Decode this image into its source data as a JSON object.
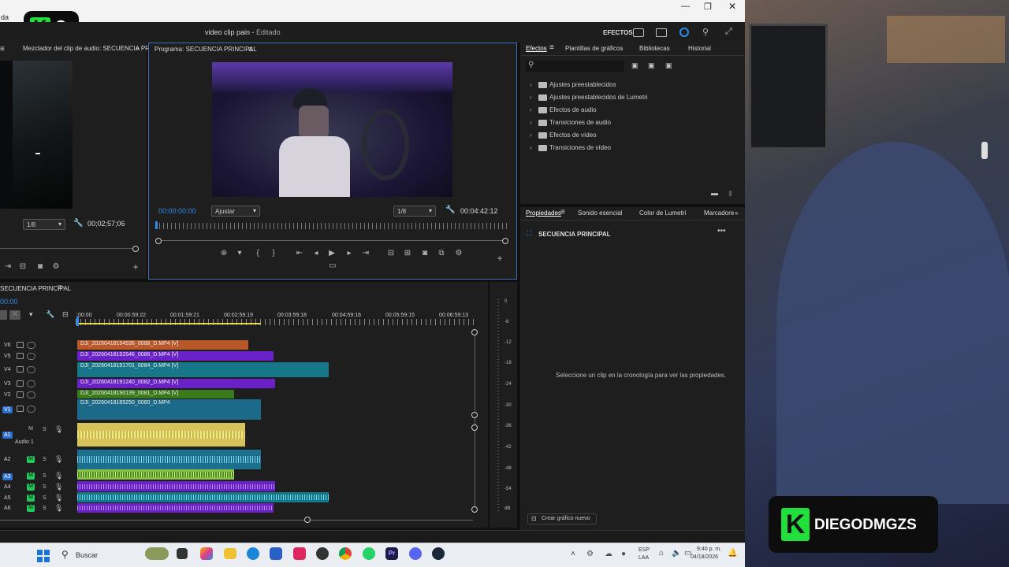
{
  "app": {
    "title": "video clip pain",
    "status": "Editado",
    "left_fragment": "da",
    "effects_label": "EFECTOS"
  },
  "logo": {
    "text": "K2"
  },
  "source_panel": {
    "title": "Mezclador del clip de audio: SECUENCIA PR",
    "zoom": "1/8",
    "timecode": "00;02;57;06"
  },
  "program_panel": {
    "title": "Programa: SECUENCIA PRINCIPAL",
    "current_tc": "00:00:00:00",
    "fit": "Ajustar",
    "res": "1/8",
    "duration": "00:04:42:12"
  },
  "effects_panel": {
    "tabs": [
      "Efectos",
      "Plantillas de gráficos",
      "Bibliotecas",
      "Historial"
    ],
    "search_placeholder": "",
    "items": [
      "Ajustes preestablecidos",
      "Ajustes preestablecidos de Lumetri",
      "Efectos de audio",
      "Transiciones de audio",
      "Efectos de vídeo",
      "Transiciones de vídeo"
    ]
  },
  "properties_panel": {
    "tabs": [
      "Propiedades",
      "Sonido esencial",
      "Color de Lumetri",
      "Marcadore"
    ],
    "sequence": "SECUENCIA PRINCIPAL",
    "empty_message": "Seleccione un clip en la cronología para ver las propiedades.",
    "create_button": "Crear gráfico nuevo"
  },
  "timeline": {
    "title": "SECUENCIA PRINCIPAL",
    "current_tc": "00:00",
    "ruler": [
      ":00:00",
      "00:00:59:22",
      "00:01:59:21",
      "00:02:59:19",
      "00:03:59:18",
      "00:04:59:16",
      "00:05:59:15",
      "00:06:59:13"
    ],
    "video_tracks": [
      {
        "name": "V6",
        "clip": "DJI_20260418194536_0088_D.MP4 [V]"
      },
      {
        "name": "V5",
        "clip": "DJI_20260418192546_0086_D.MP4 [V]"
      },
      {
        "name": "V4",
        "clip": "DJI_20260418191701_0084_D.MP4 [V]"
      },
      {
        "name": "V3",
        "clip": "DJI_20260418191240_0082_D.MP4 [V]"
      },
      {
        "name": "V2",
        "clip": "DJI_20260418190139_0081_D.MP4 [V]"
      },
      {
        "name": "V1",
        "clip": "DJI_20260418185250_0080_D.MP4"
      }
    ],
    "audio_tracks": [
      {
        "name": "A1",
        "label": "Audio 1"
      },
      {
        "name": "A2"
      },
      {
        "name": "A3"
      },
      {
        "name": "A4"
      },
      {
        "name": "A5"
      },
      {
        "name": "A6"
      }
    ],
    "mute": "M",
    "solo": "S"
  },
  "meter": {
    "ticks": [
      "0",
      "-6",
      "-12",
      "-18",
      "-24",
      "-30",
      "-36",
      "-42",
      "-48",
      "-54",
      "dB"
    ]
  },
  "taskbar": {
    "search": "Buscar",
    "lang1": "ESP",
    "lang2": "LAA",
    "time": "9:40 p. m.",
    "date": "04/18/2026"
  },
  "streamer": {
    "badge": "DIEGODMGZS"
  },
  "colors": {
    "accent": "#2d8ceb",
    "green": "#22c95a",
    "clip_orange": "#c0602a",
    "clip_purple": "#6a22c8",
    "clip_teal": "#167a8c"
  }
}
